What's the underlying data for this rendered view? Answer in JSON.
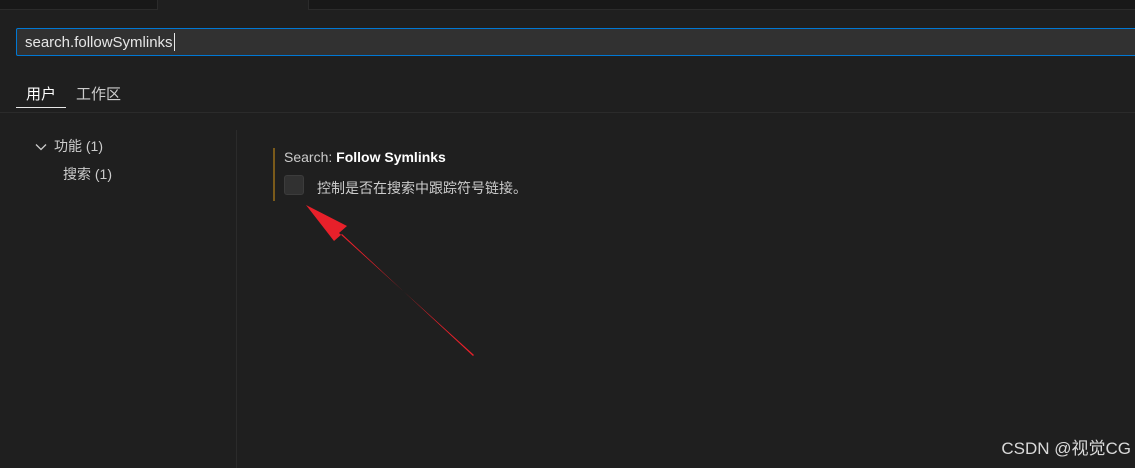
{
  "search": {
    "value": "search.followSymlinks"
  },
  "scope_tabs": [
    {
      "label": "用户",
      "active": true
    },
    {
      "label": "工作区",
      "active": false
    }
  ],
  "toc": {
    "group_label": "功能 (1)",
    "child_label": "搜索 (1)"
  },
  "setting": {
    "category": "Search: ",
    "name": "Follow Symlinks",
    "description": "控制是否在搜索中跟踪符号链接。",
    "checked": false
  },
  "annotation": {
    "arrow_color": "#e8202a"
  },
  "watermark": "CSDN @视觉CG",
  "colors": {
    "background": "#1f1f1f",
    "focus_border": "#0078d4",
    "modified_indicator": "#7a5a1a"
  }
}
